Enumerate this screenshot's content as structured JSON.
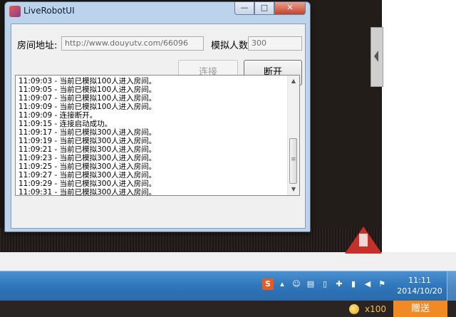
{
  "window": {
    "title": "LiveRobotUI",
    "controls": {
      "minimize": "—",
      "maximize": "□",
      "close": "✕"
    }
  },
  "form": {
    "room_label": "房间地址:",
    "room_value": "http://www.douyutv.com/66096",
    "count_label": "模拟人数:",
    "count_value": "300",
    "connect_label": "连接",
    "disconnect_label": "断开"
  },
  "log": {
    "lines": [
      "11:09:03 - 当前已模拟100人进入房间。",
      "11:09:05 - 当前已模拟100人进入房间。",
      "11:09:07 - 当前已模拟100人进入房间。",
      "11:09:09 - 当前已模拟100人进入房间。",
      "11:09:09 - 连接断开。",
      "11:09:15 - 连接启动成功。",
      "11:09:17 - 当前已模拟300人进入房间。",
      "11:09:19 - 当前已模拟300人进入房间。",
      "11:09:21 - 当前已模拟300人进入房间。",
      "11:09:23 - 当前已模拟300人进入房间。",
      "11:09:25 - 当前已模拟300人进入房间。",
      "11:09:27 - 当前已模拟300人进入房间。",
      "11:09:29 - 当前已模拟300人进入房间。",
      "11:09:31 - 当前已模拟300人进入房间。"
    ]
  },
  "taskbar": {
    "tray_icons": [
      "sogou-icon",
      "show-hidden-icon",
      "user-icon",
      "printer-icon",
      "device-icon",
      "security-icon",
      "network-icon",
      "volume-icon",
      "flag-icon"
    ],
    "time": "11:11",
    "date": "2014/10/20"
  },
  "giftbar": {
    "coin_count": "x100",
    "send_label": "赠送"
  },
  "colors": {
    "titlebar": "#bcd3ec",
    "close_button": "#c7422c",
    "taskbar": "#2f76bb",
    "send_button": "#f08a24"
  }
}
